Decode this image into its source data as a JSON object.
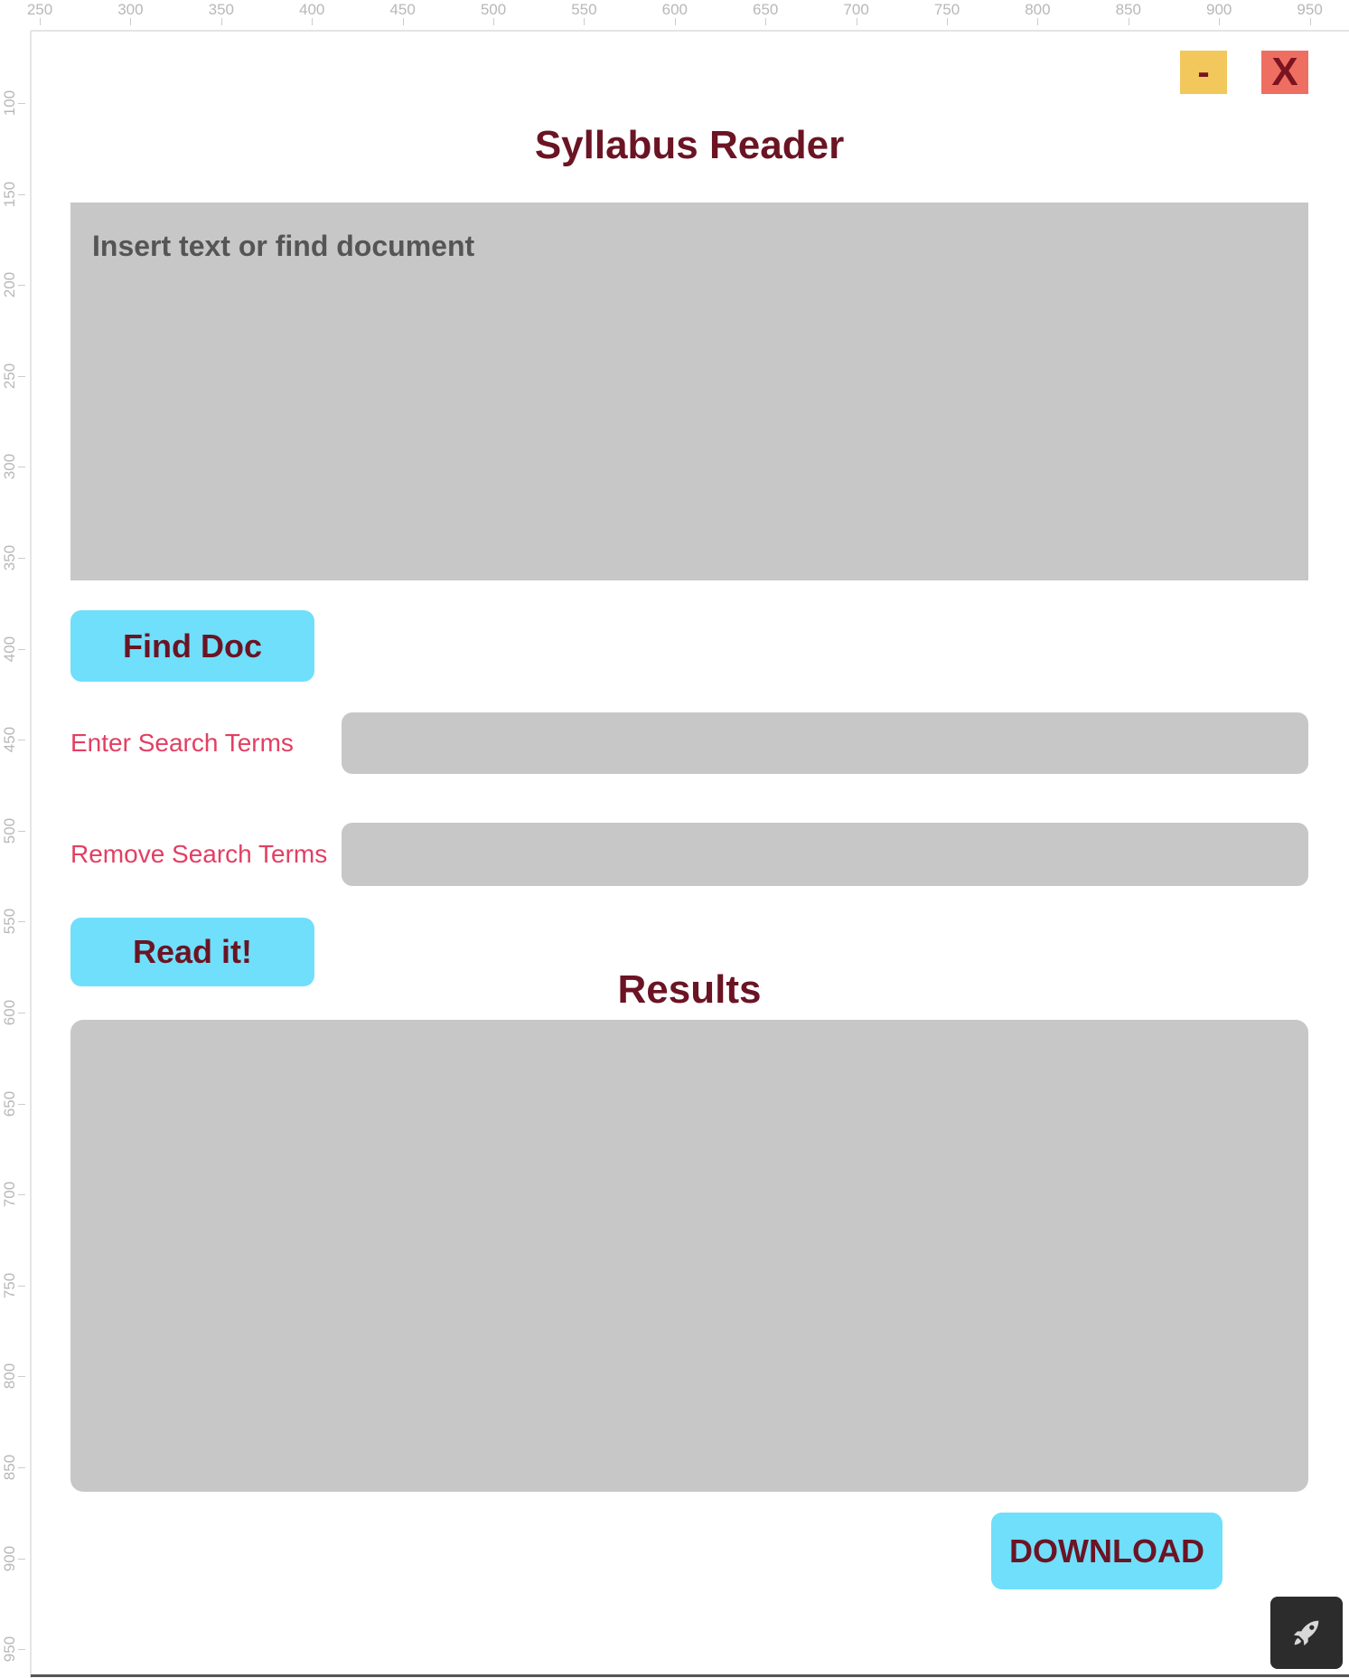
{
  "ruler": {
    "top_labels": [
      "250",
      "300",
      "350",
      "400",
      "450",
      "500",
      "550",
      "600",
      "650",
      "700",
      "750",
      "800",
      "850",
      "900",
      "950"
    ],
    "left_labels": [
      "100",
      "150",
      "200",
      "250",
      "300",
      "350",
      "400",
      "450",
      "500",
      "550",
      "600",
      "650",
      "700",
      "750",
      "800",
      "850",
      "900",
      "950"
    ]
  },
  "window": {
    "minimize_label": "-",
    "close_label": "X"
  },
  "app": {
    "title": "Syllabus Reader",
    "text_placeholder": "Insert text or find document",
    "find_doc_label": "Find Doc",
    "enter_terms_label": "Enter Search Terms",
    "remove_terms_label": "Remove Search Terms",
    "read_label": "Read it!",
    "results_title": "Results",
    "download_label": "DOWNLOAD"
  },
  "colors": {
    "title": "#6b1424",
    "label": "#e23f63",
    "button": "#6fdffb",
    "panel": "#c7c7c7",
    "minimize": "#f2c85d",
    "close": "#ef6e62"
  },
  "icons": {
    "corner": "rocket-icon"
  }
}
